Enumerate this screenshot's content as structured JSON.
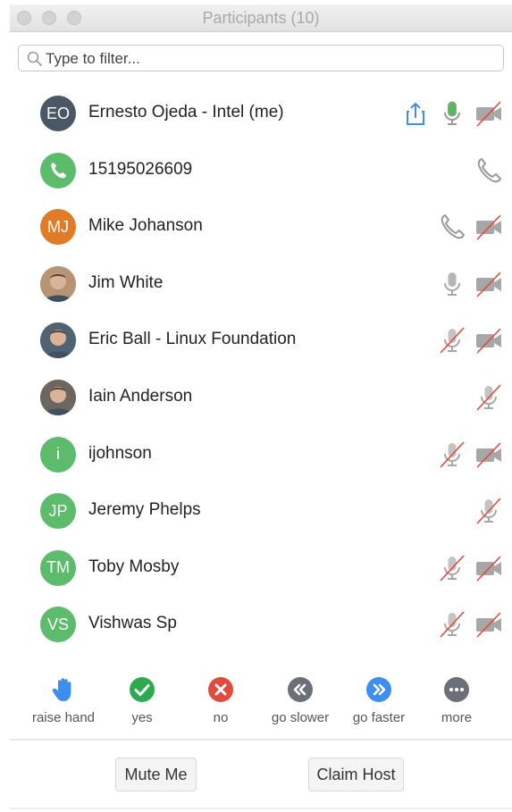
{
  "window": {
    "title": "Participants (10)"
  },
  "filter": {
    "placeholder": "Type to filter..."
  },
  "participants": [
    {
      "name": "Ernesto Ojeda - Intel (me)",
      "initials": "EO",
      "avatar_color": "#4a5766",
      "avatar_type": "initials",
      "icons": [
        "share-screen-icon",
        "mic-active-icon",
        "video-off-icon"
      ]
    },
    {
      "name": "15195026609",
      "initials": "",
      "avatar_color": "#5dbb6c",
      "avatar_type": "phone",
      "icons": [
        "phone-icon"
      ]
    },
    {
      "name": "Mike Johanson",
      "initials": "MJ",
      "avatar_color": "#e07b28",
      "avatar_type": "initials",
      "icons": [
        "phone-icon",
        "video-off-icon"
      ]
    },
    {
      "name": "Jim White",
      "initials": "",
      "avatar_color": "#b89476",
      "avatar_type": "photo",
      "icons": [
        "mic-icon",
        "video-off-icon"
      ]
    },
    {
      "name": "Eric Ball - Linux Foundation",
      "initials": "",
      "avatar_color": "#4f6372",
      "avatar_type": "photo",
      "icons": [
        "mic-muted-icon",
        "video-off-icon"
      ]
    },
    {
      "name": "Iain Anderson",
      "initials": "",
      "avatar_color": "#6d6560",
      "avatar_type": "photo",
      "icons": [
        "mic-muted-icon"
      ]
    },
    {
      "name": "ijohnson",
      "initials": "i",
      "avatar_color": "#5dbb6c",
      "avatar_type": "initials",
      "icons": [
        "mic-muted-icon",
        "video-off-icon"
      ]
    },
    {
      "name": "Jeremy Phelps",
      "initials": "JP",
      "avatar_color": "#5dbb6c",
      "avatar_type": "initials",
      "icons": [
        "mic-muted-icon"
      ]
    },
    {
      "name": "Toby Mosby",
      "initials": "TM",
      "avatar_color": "#5dbb6c",
      "avatar_type": "initials",
      "icons": [
        "mic-muted-icon",
        "video-off-icon"
      ]
    },
    {
      "name": "Vishwas Sp",
      "initials": "VS",
      "avatar_color": "#5dbb6c",
      "avatar_type": "initials",
      "icons": [
        "mic-muted-icon",
        "video-off-icon"
      ]
    }
  ],
  "reactions": [
    {
      "label": "raise hand",
      "icon": "raise-hand-icon",
      "color": "#3d8eee"
    },
    {
      "label": "yes",
      "icon": "check-icon",
      "color": "#2eaa4e"
    },
    {
      "label": "no",
      "icon": "close-icon",
      "color": "#e04b3e"
    },
    {
      "label": "go slower",
      "icon": "go-slower-icon",
      "color": "#6b6f78"
    },
    {
      "label": "go faster",
      "icon": "go-faster-icon",
      "color": "#3d8eee"
    },
    {
      "label": "more",
      "icon": "more-icon",
      "color": "#6b6f78"
    }
  ],
  "buttons": {
    "mute_me": "Mute Me",
    "claim_host": "Claim Host"
  },
  "colors": {
    "accent_blue": "#3d8eee",
    "mic_green": "#5cb85c",
    "muted_red": "#e04b3e",
    "icon_gray": "#a7a7a7"
  }
}
